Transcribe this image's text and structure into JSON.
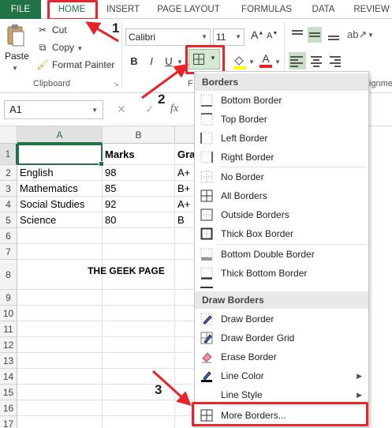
{
  "tabs": [
    "FILE",
    "HOME",
    "INSERT",
    "PAGE LAYOUT",
    "FORMULAS",
    "DATA",
    "REVIEW"
  ],
  "clipboard": {
    "paste": "Paste",
    "cut": "Cut",
    "copy": "Copy",
    "format_painter": "Format Painter",
    "group_label": "Clipboard"
  },
  "font": {
    "name": "Calibri",
    "size": "11",
    "bold": "B",
    "italic": "I",
    "underline": "U",
    "group_label_partial": "F",
    "alignment_partial": "ignme"
  },
  "formula_bar": {
    "name_box": "A1",
    "fx": "fx"
  },
  "columns": [
    "A",
    "B"
  ],
  "column_c_partial": "Gra",
  "rows": [
    "1",
    "2",
    "3",
    "4",
    "5",
    "6",
    "7",
    "8",
    "9",
    "10",
    "11",
    "12",
    "13",
    "14",
    "15",
    "16",
    "17"
  ],
  "cells": {
    "header_b": "Marks",
    "r2a": "English",
    "r2b": "98",
    "r2c": "A+",
    "r3a": "Mathematics",
    "r3b": "85",
    "r3c": "B+",
    "r4a": "Social Studies",
    "r4b": "92",
    "r4c": "A+",
    "r5a": "Science",
    "r5b": "80",
    "r5c": "B",
    "r8": "THE GEEK PAGE"
  },
  "menu": {
    "heading_borders": "Borders",
    "heading_draw": "Draw Borders",
    "items": {
      "bottom": "Bottom Border",
      "top": "Top Border",
      "left": "Left Border",
      "right": "Right Border",
      "none": "No Border",
      "all": "All Borders",
      "outside": "Outside Borders",
      "thickbox": "Thick Box Border",
      "bottomdouble": "Bottom Double Border",
      "thickbottom": "Thick Bottom Border",
      "draw": "Draw Border",
      "drawgrid": "Draw Border Grid",
      "erase": "Erase Border",
      "color": "Line Color",
      "style": "Line Style",
      "more": "More Borders..."
    }
  },
  "annotations": [
    "1",
    "2",
    "3"
  ],
  "colors": {
    "excel_green": "#217346",
    "highlight_red": "#e8232a",
    "font_color_red": "#e8232a",
    "fill_yellow": "#ffff00"
  }
}
